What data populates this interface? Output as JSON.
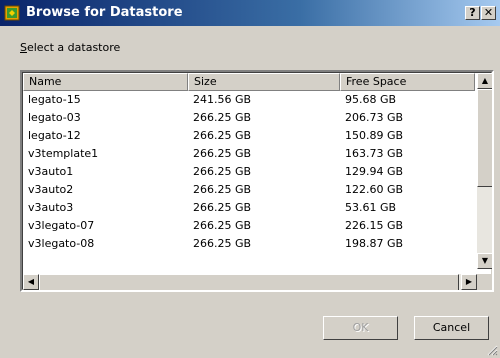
{
  "window": {
    "title": "Browse for Datastore",
    "help_label": "?",
    "close_label": "✕",
    "icon": "datastore-icon"
  },
  "prompt": {
    "accesskey": "S",
    "rest": "elect a datastore"
  },
  "table": {
    "columns": [
      "Name",
      "Size",
      "Free Space"
    ],
    "rows": [
      {
        "name": "legato-15",
        "size": "241.56 GB",
        "free": "95.68 GB"
      },
      {
        "name": "legato-03",
        "size": "266.25 GB",
        "free": "206.73 GB"
      },
      {
        "name": "legato-12",
        "size": "266.25 GB",
        "free": "150.89 GB"
      },
      {
        "name": "v3template1",
        "size": "266.25 GB",
        "free": "163.73 GB"
      },
      {
        "name": "v3auto1",
        "size": "266.25 GB",
        "free": "129.94 GB"
      },
      {
        "name": "v3auto2",
        "size": "266.25 GB",
        "free": "122.60 GB"
      },
      {
        "name": "v3auto3",
        "size": "266.25 GB",
        "free": "53.61 GB"
      },
      {
        "name": "v3legato-07",
        "size": "266.25 GB",
        "free": "226.15 GB"
      },
      {
        "name": "v3legato-08",
        "size": "266.25 GB",
        "free": "198.87 GB"
      }
    ]
  },
  "scroll": {
    "up": "▲",
    "down": "▼",
    "left": "◀",
    "right": "▶"
  },
  "buttons": {
    "ok": "OK",
    "cancel": "Cancel"
  }
}
